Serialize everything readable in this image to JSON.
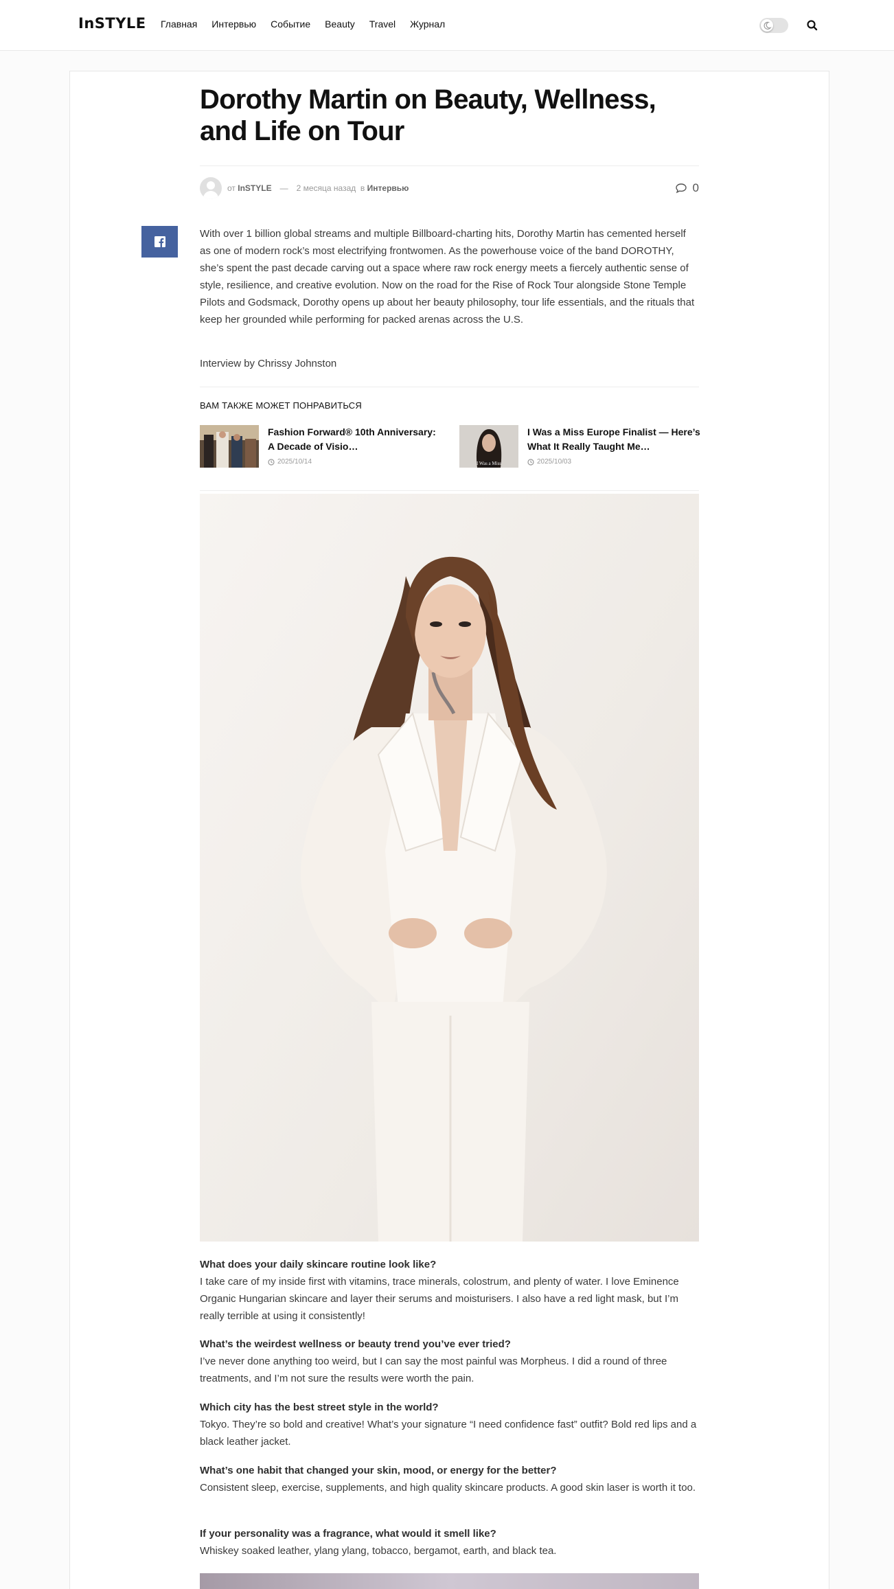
{
  "header": {
    "logo": "InSTYLE",
    "nav": [
      "Главная",
      "Интервью",
      "Событие",
      "Beauty",
      "Travel",
      "Журнал"
    ]
  },
  "article": {
    "title": "Dorothy Martin on Beauty, Wellness, and Life on Tour",
    "meta": {
      "by_prefix": "от",
      "author": "InSTYLE",
      "dash": "—",
      "time": "2 месяца назад",
      "in_prefix": "в",
      "category": "Интервью",
      "comments": "0"
    },
    "lead": "With over 1 billion global streams and multiple Billboard-charting hits, Dorothy Martin has cemented herself as one of modern rock’s most electrifying frontwomen. As the powerhouse voice of the band DOROTHY, she’s spent the past decade carving out a space where raw rock energy meets a fiercely authentic sense of style, resilience, and creative evolution. Now on the road for the Rise of Rock Tour alongside Stone Temple Pilots and Godsmack, Dorothy opens up about her beauty philosophy, tour life essentials, and the rituals that keep her grounded while performing for packed arenas across the U.S.",
    "byline": "Interview by Chrissy Johnston"
  },
  "related": {
    "heading": "ВАМ ТАКЖЕ МОЖЕТ ПОНРАВИТЬСЯ",
    "items": [
      {
        "title": "Fashion Forward® 10th Anniversary: A Decade of Visio…",
        "date": "2025/10/14"
      },
      {
        "title": "I Was a Miss Europe Finalist — Here’s What It Really Taught Me…",
        "date": "2025/10/03",
        "thumb_caption": "I Was a Miss"
      }
    ]
  },
  "qa": [
    {
      "q": "What does your daily skincare routine look like?",
      "a": "I take care of my inside first with vitamins, trace minerals, colostrum, and plenty of water. I love Eminence Organic Hungarian skincare and layer their serums and moisturisers. I also have a red light mask, but I’m really terrible at using it consistently!"
    },
    {
      "q": "What’s the weirdest wellness or beauty trend you’ve ever tried?",
      "a": "I’ve never done anything too weird, but I can say the most painful was Morpheus. I did a round of three treatments, and I’m not sure the results were worth the pain."
    },
    {
      "q": "Which city has the best street style in the world?",
      "a": "Tokyo. They’re so bold and creative! What’s your signature “I need confidence fast” outfit? Bold red lips and a black leather jacket."
    },
    {
      "q": "What’s one habit that changed your skin, mood, or energy for the better?",
      "a": "Consistent sleep, exercise, supplements, and high quality skincare products. A good skin laser is worth it too."
    },
    {
      "q": "If your personality was a fragrance, what would it smell like?",
      "a": "Whiskey soaked leather, ylang ylang, tobacco, bergamot, earth, and black tea."
    }
  ],
  "colors": {
    "facebook": "#45629f",
    "text": "#3a3a3a",
    "title": "#111111"
  },
  "icons": [
    "search-icon",
    "moon-icon",
    "comment-icon",
    "facebook-icon",
    "clock-icon"
  ]
}
